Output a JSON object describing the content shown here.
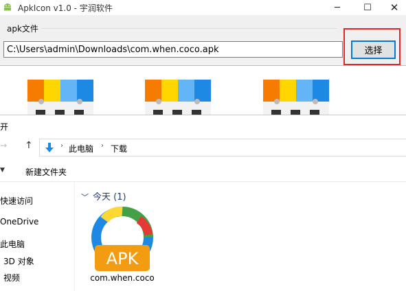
{
  "app": {
    "title": "ApkIcon v1.0 - 宇润软件",
    "group_label": "apk文件",
    "apk_path": "C:\\Users\\admin\\Downloads\\com.when.coco.apk",
    "select_label": "选择",
    "preview_icon": "calendar-365-icon",
    "highlight_color": "#e22727"
  },
  "explorer": {
    "title_fragment": "开",
    "breadcrumb": [
      "此电脑",
      "下载"
    ],
    "new_folder_label": "新建文件夹",
    "nav_items": [
      "快速访问",
      "OneDrive",
      "此电脑",
      "3D 对象",
      "视频"
    ],
    "group_header": "今天 (1)",
    "file": {
      "name": "com.when.coco",
      "icon_text": "APK",
      "icon": "apk-file-icon"
    }
  },
  "colors": {
    "accent": "#0078d7",
    "apk_orange": "#f39c12"
  }
}
